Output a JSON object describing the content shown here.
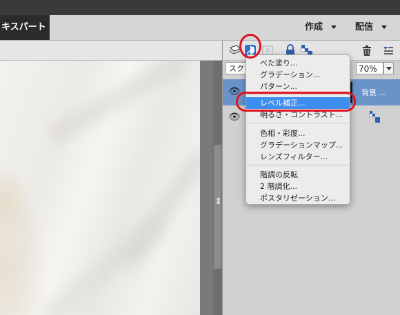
{
  "header": {
    "mode_label": "キスパート",
    "create_label": "作成",
    "share_label": "配信"
  },
  "layers_panel": {
    "blend_mode": "スク",
    "opacity": "70%",
    "layers": [
      {
        "name": "背景 ...",
        "selected": true
      },
      {
        "name": "",
        "selected": false
      }
    ]
  },
  "adjustment_menu": {
    "groups": [
      [
        "べた塗り...",
        "グラデーション...",
        "パターン..."
      ],
      [
        "レベル補正...",
        "明るさ・コントラスト..."
      ],
      [
        "色相・彩度...",
        "グラデーションマップ...",
        "レンズフィルター..."
      ],
      [
        "階調の反転",
        "2 階調化...",
        "ポスタリゼーション..."
      ]
    ],
    "selected": "レベル補正..."
  },
  "colors": {
    "highlight": "#3d8ef0",
    "annotation_red": "#e0121f",
    "selected_layer": "#6a93c8"
  },
  "icons": [
    "new-layer-icon",
    "adjustment-layer-icon",
    "layer-mask-icon",
    "lock-icon",
    "lock-transparency-icon",
    "trash-icon",
    "panel-menu-icon",
    "eye-icon",
    "layer-lock-icon"
  ]
}
